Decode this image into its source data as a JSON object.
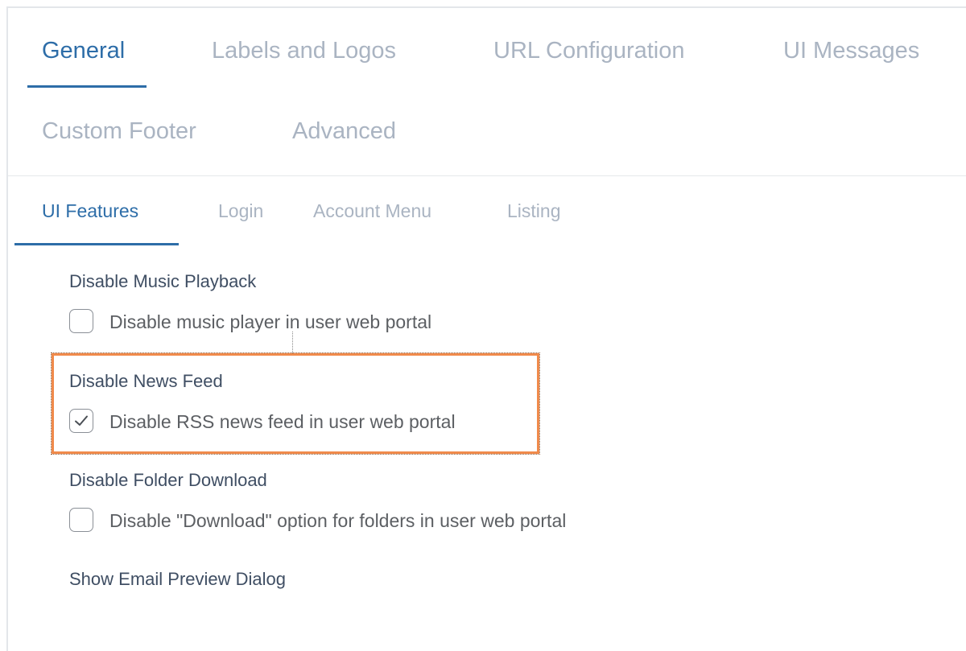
{
  "main_tabs": [
    {
      "label": "General",
      "active": true
    },
    {
      "label": "Labels and Logos",
      "active": false
    },
    {
      "label": "URL Configuration",
      "active": false
    },
    {
      "label": "UI Messages",
      "active": false
    },
    {
      "label": "Custom Footer",
      "active": false
    },
    {
      "label": "Advanced",
      "active": false
    }
  ],
  "sub_tabs": [
    {
      "label": "UI Features",
      "active": true
    },
    {
      "label": "Login",
      "active": false
    },
    {
      "label": "Account Menu",
      "active": false
    },
    {
      "label": "Listing",
      "active": false
    }
  ],
  "settings": [
    {
      "title": "Disable Music Playback",
      "option": "Disable music player in user web portal",
      "checked": false
    },
    {
      "title": "Disable News Feed",
      "option": "Disable RSS news feed in user web portal",
      "checked": true
    },
    {
      "title": "Disable Folder Download",
      "option": "Disable \"Download\" option for folders in user web portal",
      "checked": false
    },
    {
      "title": "Show Email Preview Dialog"
    }
  ],
  "colors": {
    "accent": "#2d6da8",
    "inactive_tab": "#aab4c2",
    "highlight_border": "#f08a4b"
  }
}
